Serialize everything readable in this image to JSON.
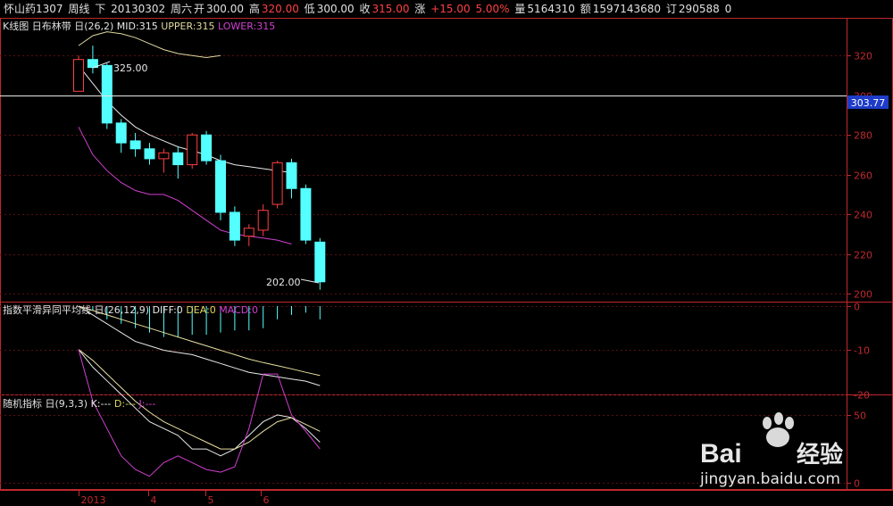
{
  "header": {
    "stock_name": "怀山药1307",
    "period": "周线",
    "direction": "下",
    "date": "20130302",
    "weekday": "周六",
    "open_label": "开",
    "open": "300.00",
    "high_label": "高",
    "high": "320.00",
    "low_label": "低",
    "low": "300.00",
    "close_label": "收",
    "close": "315.00",
    "change_label": "涨",
    "change": "+15.00",
    "change_pct": "5.00%",
    "volume_label": "量",
    "volume": "5164310",
    "amount_label": "额",
    "amount": "1597143680",
    "orders_label": "订",
    "orders": "290588",
    "extra": "0"
  },
  "panels": {
    "main": {
      "title": "K线图",
      "indicator": "日布林带",
      "params_prefix": "日",
      "params": "(26,2)",
      "mid_label": "MID:315",
      "upper_label": "UPPER:315",
      "lower_label": "LOWER:315",
      "high_marker": "325.00",
      "low_marker": "202.00",
      "crosshair_value": "303.77",
      "y_ticks": [
        "320",
        "300",
        "280",
        "260",
        "240",
        "220",
        "200"
      ]
    },
    "macd": {
      "title": "指数平滑异同平均线",
      "params_prefix": "日",
      "params": "(26,12,9)",
      "diff_label": "DIFF:0",
      "dea_label": "DEA:0",
      "macd_label": "MACD:0",
      "y_ticks": [
        "0",
        "-10",
        "-20"
      ]
    },
    "kdj": {
      "title": "随机指标",
      "params_prefix": "日",
      "params": "(9,3,3)",
      "k_label": "K:---",
      "d_label": "D:---",
      "j_label": "J:---",
      "y_ticks": [
        "50",
        "0"
      ]
    }
  },
  "x_axis": {
    "labels": [
      "2013",
      "4",
      "5",
      "6"
    ]
  },
  "colors": {
    "up_candle": "#ff4040",
    "down_candle": "#54ffff",
    "axis": "#c0282e",
    "grid": "#5a0f12",
    "mid_line": "#e8e8e8",
    "upper_line": "#e0d8a0",
    "lower_line": "#d040d0",
    "dea_line": "#e8e0a0",
    "tag_bg": "#1e3cc8"
  },
  "watermark": {
    "brand": "Bai",
    "brand_suffix": "经验",
    "url": "jingyan.baidu.com"
  },
  "chart_data": {
    "type": "candlestick",
    "candles": [
      {
        "open": 302,
        "close": 318,
        "high": 320,
        "low": 302
      },
      {
        "open": 318,
        "close": 314,
        "high": 325,
        "low": 311
      },
      {
        "open": 315,
        "close": 286,
        "high": 316,
        "low": 283
      },
      {
        "open": 286,
        "close": 276,
        "high": 288,
        "low": 271
      },
      {
        "open": 277,
        "close": 273,
        "high": 281,
        "low": 269
      },
      {
        "open": 273,
        "close": 268,
        "high": 276,
        "low": 265
      },
      {
        "open": 268,
        "close": 271,
        "high": 273,
        "low": 261
      },
      {
        "open": 271,
        "close": 265,
        "high": 274,
        "low": 258
      },
      {
        "open": 265,
        "close": 280,
        "high": 281,
        "low": 263
      },
      {
        "open": 280,
        "close": 267,
        "high": 282,
        "low": 265
      },
      {
        "open": 267,
        "close": 241,
        "high": 270,
        "low": 237
      },
      {
        "open": 241,
        "close": 227,
        "high": 244,
        "low": 224
      },
      {
        "open": 229,
        "close": 233,
        "high": 235,
        "low": 224
      },
      {
        "open": 232,
        "close": 242,
        "high": 245,
        "low": 229
      },
      {
        "open": 245,
        "close": 266,
        "high": 267,
        "low": 243
      },
      {
        "open": 266,
        "close": 253,
        "high": 268,
        "low": 248
      },
      {
        "open": 253,
        "close": 227,
        "high": 255,
        "low": 225
      },
      {
        "open": 226,
        "close": 206,
        "high": 228,
        "low": 202
      }
    ],
    "boll_mid": [
      315,
      306,
      297,
      290,
      284,
      280,
      277,
      274,
      272,
      270,
      267,
      265,
      264,
      263,
      262,
      261
    ],
    "boll_upper": [
      325,
      330,
      332,
      331,
      329,
      326,
      323,
      321,
      320,
      319,
      320
    ],
    "boll_lower": [
      284,
      270,
      262,
      256,
      252,
      250,
      250,
      247,
      242,
      237,
      232,
      230,
      229,
      228,
      227,
      225
    ],
    "macd_diff": [
      0,
      -2,
      -4,
      -6,
      -8,
      -9,
      -10,
      -10.5,
      -11,
      -12,
      -13,
      -14,
      -15,
      -15.5,
      -16,
      -16.5,
      -17,
      -18
    ],
    "macd_dea": [
      0,
      -1,
      -2,
      -3,
      -4,
      -5,
      -6,
      -7,
      -8,
      -9,
      -10,
      -11,
      -12,
      -12.8,
      -13.5,
      -14.2,
      -15,
      -15.7
    ],
    "macd_hist": [
      0,
      -1,
      -3,
      -4,
      -5,
      -6,
      -7,
      -7,
      -6.5,
      -6.5,
      -6,
      -5.5,
      -5.5,
      -5,
      -3,
      -2,
      -1.5,
      -3
    ],
    "kdj_k": [
      98,
      85,
      75,
      65,
      55,
      45,
      40,
      35,
      25,
      25,
      20,
      25,
      35,
      45,
      50,
      48,
      40,
      30
    ],
    "kdj_d": [
      98,
      90,
      80,
      70,
      60,
      52,
      45,
      40,
      35,
      30,
      25,
      25,
      30,
      38,
      45,
      48,
      43,
      38
    ],
    "kdj_j": [
      98,
      60,
      40,
      20,
      10,
      5,
      15,
      20,
      15,
      10,
      8,
      12,
      40,
      80,
      80,
      50,
      38,
      25
    ],
    "y_ranges": {
      "main": [
        196,
        339
      ],
      "macd": [
        -20,
        1
      ],
      "kdj": [
        -5,
        65
      ]
    }
  }
}
